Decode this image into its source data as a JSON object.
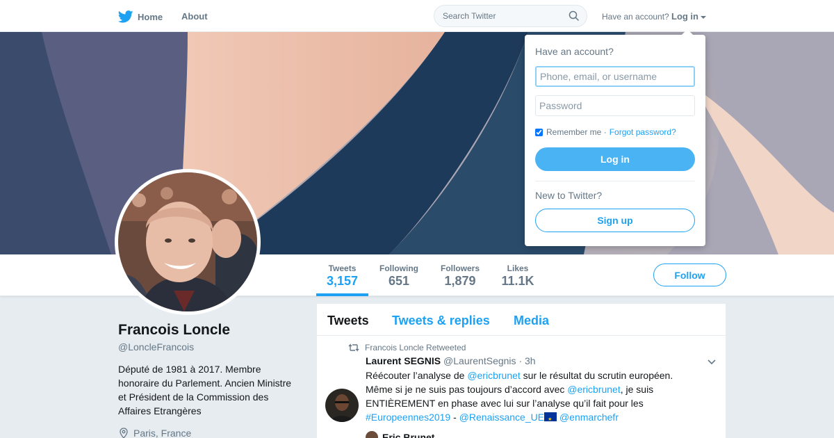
{
  "nav": {
    "home_label": "Home",
    "about_label": "About",
    "search_placeholder": "Search Twitter",
    "have_account": "Have an account?",
    "login_label": "Log in"
  },
  "profile": {
    "name": "Francois Loncle",
    "handle": "@LoncleFrancois",
    "bio": "Député de 1981 à 2017. Membre honoraire du Parlement. Ancien Ministre et Président de la Commission des Affaires Etrangères",
    "location": "Paris, France",
    "follow_label": "Follow"
  },
  "stats": [
    {
      "label": "Tweets",
      "value": "3,157"
    },
    {
      "label": "Following",
      "value": "651"
    },
    {
      "label": "Followers",
      "value": "1,879"
    },
    {
      "label": "Likes",
      "value": "11.1K"
    }
  ],
  "timeline": {
    "tabs": [
      "Tweets",
      "Tweets & replies",
      "Media"
    ]
  },
  "tweet": {
    "retweeted_by": "Francois Loncle Retweeted",
    "author_name": "Laurent SEGNIS",
    "author_handle": "@LaurentSegnis",
    "time": "· 3h",
    "text_1": "Réécouter l’analyse de ",
    "mention_1": "@ericbrunet",
    "text_2": " sur le résultat du scrutin européen. Même si je ne suis pas toujours d’accord avec ",
    "mention_2": "@ericbrunet",
    "text_3": ", je suis ENTIÈREMENT en phase avec lui sur l’analyse qu’il fait pour les ",
    "hashtag": "#Europeennes2019",
    "text_4": " - ",
    "mention_3": "@Renaissance_UE",
    "mention_4": "@enmarchefr",
    "quoted_name": "Eric Brunet"
  },
  "login_dropdown": {
    "title": "Have an account?",
    "username_placeholder": "Phone, email, or username",
    "password_placeholder": "Password",
    "remember_label": "Remember me",
    "separator": "·",
    "forgot_label": "Forgot password?",
    "login_button": "Log in",
    "new_label": "New to Twitter?",
    "signup_button": "Sign up"
  },
  "colors": {
    "accent": "#1da1f2",
    "login_button": "#4ab3f4",
    "page_bg": "#e6ecf0"
  }
}
